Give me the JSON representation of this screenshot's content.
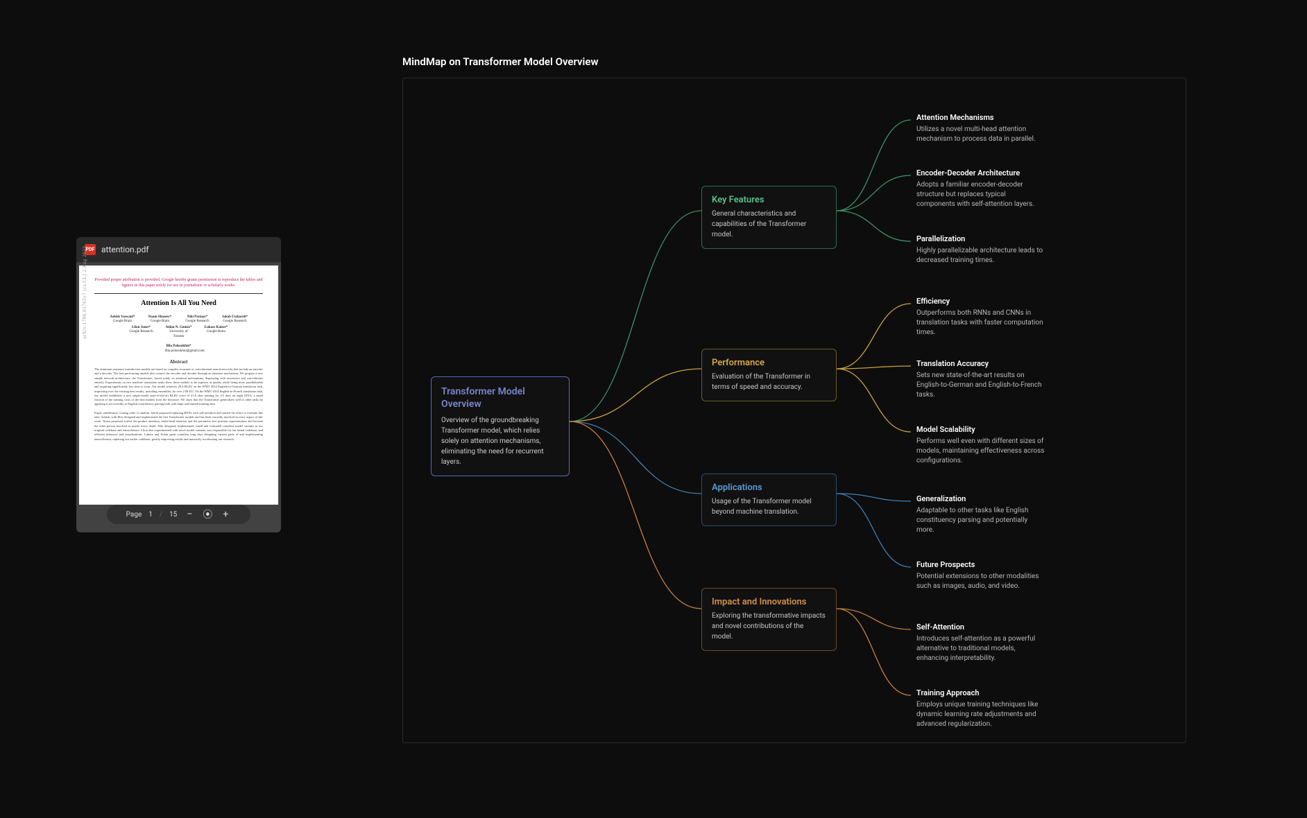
{
  "pdf": {
    "filename": "attention.pdf",
    "ribbon": "Provided proper attribution is provided, Google hereby grants permission to reproduce the tables and figures in this paper solely for use in journalistic or scholarly works.",
    "title": "Attention Is All You Need",
    "vertical": "arXiv:1706.03762v7  [cs.CL]  2 Aug 2023",
    "abstract_h": "Abstract",
    "abstract1": "The dominant sequence transduction models are based on complex recurrent or convolutional neural networks that include an encoder and a decoder. The best performing models also connect the encoder and decoder through an attention mechanism. We propose a new simple network architecture, the Transformer, based solely on attention mechanisms, dispensing with recurrence and convolutions entirely. Experiments on two machine translation tasks show these models to be superior in quality while being more parallelizable and requiring significantly less time to train. Our model achieves 28.4 BLEU on the WMT 2014 English-to-German translation task, improving over the existing best results, including ensembles, by over 2 BLEU. On the WMT 2014 English-to-French translation task, our model establishes a new single-model state-of-the-art BLEU score of 41.8 after training for 3.5 days on eight GPUs, a small fraction of the training costs of the best models from the literature. We show that the Transformer generalizes well to other tasks by applying it successfully to English constituency parsing both with large and limited training data.",
    "abstract2": "Equal contribution. Listing order is random. Jakob proposed replacing RNNs with self-attention and started the effort to evaluate this idea. Ashish, with Illia, designed and implemented the first Transformer models and has been crucially involved in every aspect of this work. Noam proposed scaled dot-product attention, multi-head attention and the parameter-free position representation and became the other person involved in nearly every detail. Niki designed, implemented, tuned and evaluated countless model variants in our original codebase and tensor2tensor. Llion also experimented with novel model variants, was responsible for our initial codebase, and efficient inference and visualizations. Lukasz and Aidan spent countless long days designing various parts of and implementing tensor2tensor, replacing our earlier codebase, greatly improving results and massively accelerating our research.",
    "toolbar": {
      "page_label": "Page",
      "current": "1",
      "sep": "/",
      "total": "15"
    }
  },
  "mindmap": {
    "title": "MindMap on Transformer Model Overview",
    "root": {
      "title": "Transformer Model Overview",
      "desc": "Overview of the groundbreaking Transformer model, which relies solely on attention mechanisms, eliminating the need for recurrent layers."
    },
    "branches": [
      {
        "color": "green",
        "title": "Key Features",
        "desc": "General characteristics and capabilities of the Transformer model."
      },
      {
        "color": "yellow",
        "title": "Performance",
        "desc": "Evaluation of the Transformer in terms of speed and accuracy."
      },
      {
        "color": "blue",
        "title": "Applications",
        "desc": "Usage of the Transformer model beyond machine translation."
      },
      {
        "color": "orange",
        "title": "Impact and Innovations",
        "desc": "Exploring the transformative impacts and novel contributions of the model."
      }
    ],
    "leaves": [
      {
        "parent": 0,
        "title": "Attention Mechanisms",
        "desc": "Utilizes a novel multi-head attention mechanism to process data in parallel."
      },
      {
        "parent": 0,
        "title": "Encoder-Decoder Architecture",
        "desc": "Adopts a familiar encoder-decoder structure but replaces typical components with self-attention layers."
      },
      {
        "parent": 0,
        "title": "Parallelization",
        "desc": "Highly parallelizable architecture leads to decreased training times."
      },
      {
        "parent": 1,
        "title": "Efficiency",
        "desc": "Outperforms both RNNs and CNNs in translation tasks with faster computation times."
      },
      {
        "parent": 1,
        "title": "Translation Accuracy",
        "desc": "Sets new state-of-the-art results on English-to-German and English-to-French tasks."
      },
      {
        "parent": 1,
        "title": "Model Scalability",
        "desc": "Performs well even with different sizes of models, maintaining effectiveness across configurations."
      },
      {
        "parent": 2,
        "title": "Generalization",
        "desc": "Adaptable to other tasks like English constituency parsing and potentially more."
      },
      {
        "parent": 2,
        "title": "Future Prospects",
        "desc": "Potential extensions to other modalities such as images, audio, and video."
      },
      {
        "parent": 3,
        "title": "Self-Attention",
        "desc": "Introduces self-attention as a powerful alternative to traditional models, enhancing interpretability."
      },
      {
        "parent": 3,
        "title": "Training Approach",
        "desc": "Employs unique training techniques like dynamic learning rate adjustments and advanced regularization."
      }
    ]
  }
}
